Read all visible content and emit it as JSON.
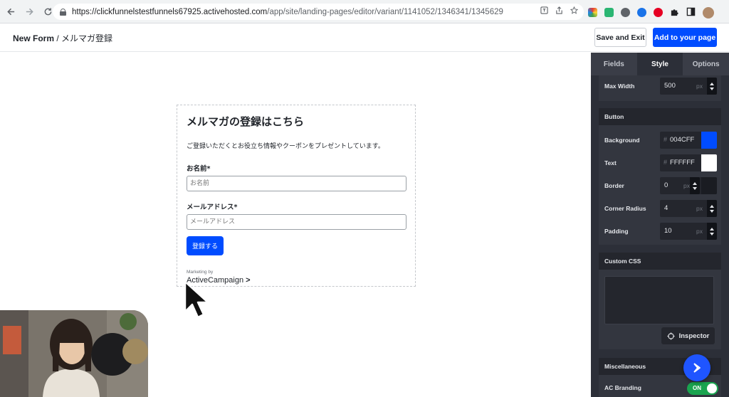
{
  "browser": {
    "url_host": "https://clickfunnelstestfunnels67925.activehosted.com",
    "url_path": "/app/site/landing-pages/editor/variant/1141052/1346341/1345629"
  },
  "header": {
    "title_bold": "New Form",
    "title_rest": " / メルマガ登録",
    "save_exit_label": "Save and Exit",
    "add_to_page_label": "Add to your page"
  },
  "form": {
    "heading": "メルマガの登録はこちら",
    "description": "ご登録いただくとお役立ち情報やクーポンをプレゼントしています。",
    "name_label": "お名前*",
    "name_placeholder": "お名前",
    "email_label": "メールアドレス*",
    "email_placeholder": "メールアドレス",
    "submit_label": "登録する",
    "marketing_by": "Marketing by",
    "brand": "ActiveCampaign"
  },
  "panel": {
    "tabs": [
      {
        "label": "Fields",
        "active": false
      },
      {
        "label": "Style",
        "active": true
      },
      {
        "label": "Options",
        "active": false
      }
    ],
    "max_width": {
      "label": "Max Width",
      "value": "500",
      "unit": "px"
    },
    "button_section": {
      "title": "Button",
      "background": {
        "label": "Background",
        "hash": "#",
        "value": "004CFF",
        "color": "#004CFF"
      },
      "text": {
        "label": "Text",
        "hash": "#",
        "value": "FFFFFF",
        "color": "#FFFFFF"
      },
      "border": {
        "label": "Border",
        "value": "0",
        "unit": "px"
      },
      "corner_radius": {
        "label": "Corner Radius",
        "value": "4",
        "unit": "px"
      },
      "padding": {
        "label": "Padding",
        "value": "10",
        "unit": "px"
      }
    },
    "custom_css": {
      "title": "Custom CSS",
      "inspector_label": "Inspector"
    },
    "misc": {
      "title": "Miscellaneous",
      "ac_branding_label": "AC Branding",
      "toggle_label": "ON"
    }
  },
  "colors": {
    "accent": "#004CFF",
    "panel_bg": "#2C2F38",
    "toggle_on": "#1AA44F"
  },
  "icons": [
    "back-arrow-icon",
    "forward-arrow-icon",
    "reload-icon",
    "lock-icon",
    "translate-icon",
    "share-icon",
    "star-icon",
    "puzzle-icon",
    "sidebar-icon",
    "crosshair-icon",
    "send-icon",
    "cursor-icon"
  ]
}
